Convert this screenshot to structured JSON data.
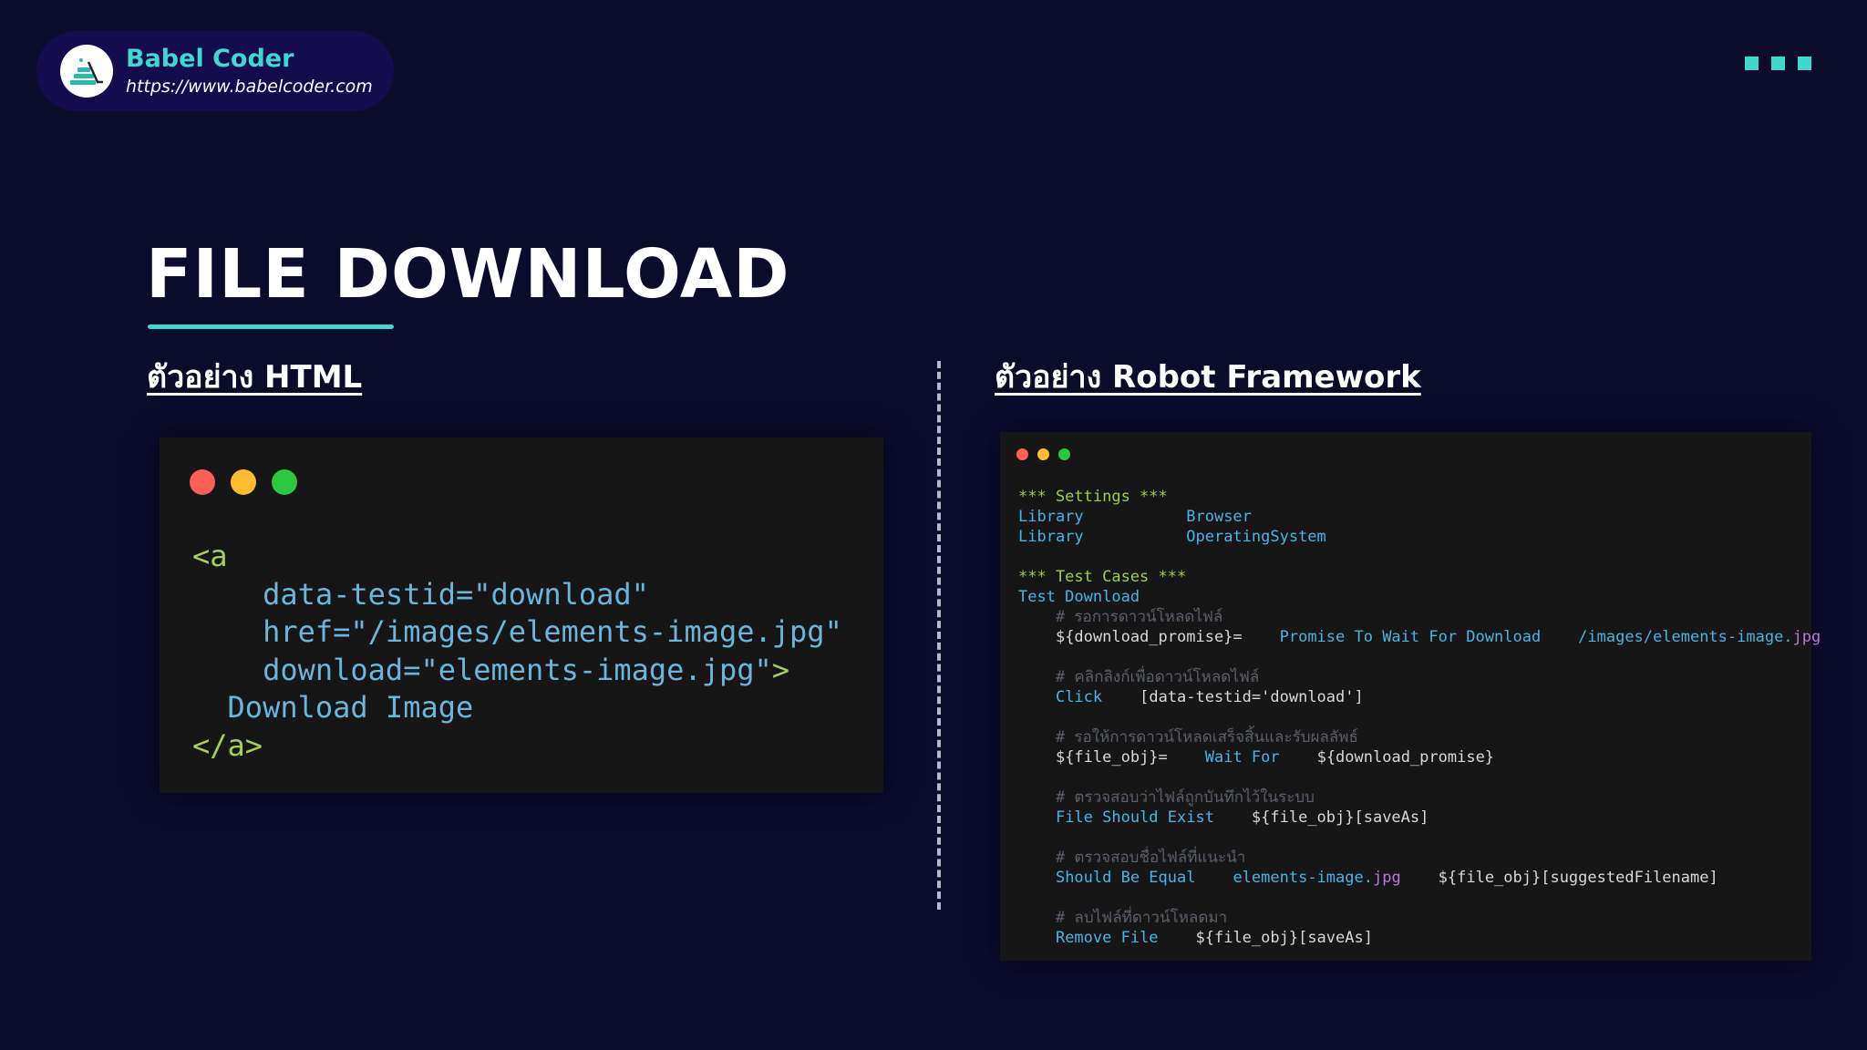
{
  "brand": {
    "name": "Babel Coder",
    "url": "https://www.babelcoder.com"
  },
  "title": "FILE DOWNLOAD",
  "sections": {
    "html_heading": "ตัวอย่าง HTML",
    "robot_heading": "ตัวอย่าง Robot Framework"
  },
  "html_code": {
    "line1_open": "<a",
    "line2": "data-testid=\"download\"",
    "line3": "href=\"/images/elements-image.jpg\"",
    "line4_attr": "download=\"elements-image.jpg\"",
    "line4_close": ">",
    "line5": "Download Image",
    "line6": "</a>"
  },
  "robot_code": {
    "settings_header": "*** Settings ***",
    "lib1_kw": "Library",
    "lib1_val": "Browser",
    "lib2_kw": "Library",
    "lib2_val": "OperatingSystem",
    "testcases_header": "*** Test Cases ***",
    "test_name": "Test Download",
    "c1": "# รอการดาวน์โหลดไฟล์",
    "l1_var": "${download_promise}=",
    "l1_kw": "Promise To Wait For Download",
    "l1_arg": "/images/elements-image.",
    "l1_ext": "jpg",
    "c2": "# คลิกลิงก์เพื่อดาวน์โหลดไฟล์",
    "l2_kw": "Click",
    "l2_arg": "[data-testid='download']",
    "c3": "# รอให้การดาวน์โหลดเสร็จสิ้นและรับผลลัพธ์",
    "l3_var": "${file_obj}=",
    "l3_kw": "Wait For",
    "l3_arg": "${download_promise}",
    "c4": "# ตรวจสอบว่าไฟล์ถูกบันทึกไว้ในระบบ",
    "l4_kw": "File Should Exist",
    "l4_arg": "${file_obj}[saveAs]",
    "c5": "# ตรวจสอบชื่อไฟล์ที่แนะนำ",
    "l5_kw": "Should Be Equal",
    "l5_arg1": "elements-image.",
    "l5_ext": "jpg",
    "l5_arg2": "${file_obj}[suggestedFilename]",
    "c6": "# ลบไฟล์ที่ดาวน์โหลดมา",
    "l6_kw": "Remove File",
    "l6_arg": "${file_obj}[saveAs]"
  },
  "colors": {
    "background": "#0b0b2c",
    "accent": "#3ed8cf",
    "brand_pill": "#150c4e",
    "code_bg": "#161616",
    "traffic_red": "#fe5f57",
    "traffic_yellow": "#febc2e",
    "traffic_green": "#28c840"
  },
  "icons": {
    "logo": "babel-coder-logo",
    "menu": "three-squares-icon"
  }
}
